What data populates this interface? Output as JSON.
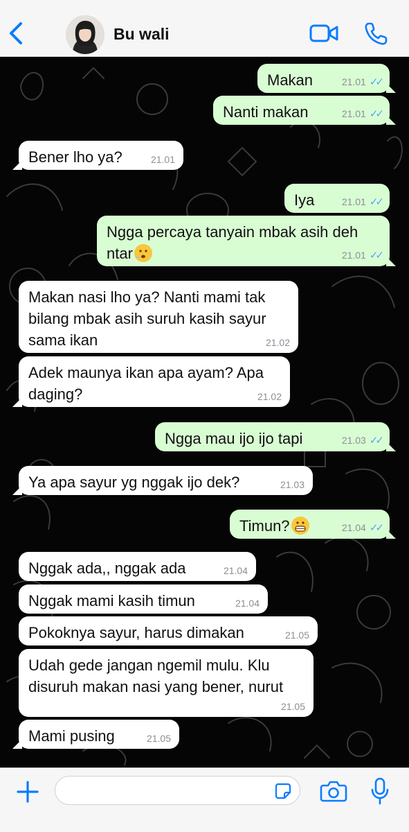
{
  "header": {
    "contact_name": "Bu wali",
    "back_icon": "chevron-left-icon",
    "video_icon": "video-camera-icon",
    "call_icon": "phone-icon"
  },
  "messages": [
    {
      "dir": "out",
      "text": "Makan",
      "time": "21.01"
    },
    {
      "dir": "out",
      "text": "Nanti makan",
      "time": "21.01"
    },
    {
      "dir": "in",
      "text": "Bener lho ya?",
      "time": "21.01"
    },
    {
      "dir": "out",
      "text": "Iya",
      "time": "21.01"
    },
    {
      "dir": "out",
      "text": "Ngga percaya tanyain mbak asih deh ntar",
      "emoji": "face-with-steam-emoji",
      "time": "21.01"
    },
    {
      "dir": "in",
      "text": "Makan nasi lho ya? Nanti mami tak bilang mbak asih suruh kasih sayur sama ikan",
      "time": "21.02"
    },
    {
      "dir": "in",
      "text": "Adek maunya ikan apa ayam? Apa daging?",
      "time": "21.02"
    },
    {
      "dir": "out",
      "text": "Ngga mau ijo ijo tapi",
      "time": "21.03"
    },
    {
      "dir": "in",
      "text": "Ya apa sayur yg nggak ijo dek?",
      "time": "21.03"
    },
    {
      "dir": "out",
      "text": "Timun?",
      "emoji": "grimacing-face-emoji",
      "time": "21.04"
    },
    {
      "dir": "in",
      "text": "Nggak ada,, nggak ada",
      "time": "21.04"
    },
    {
      "dir": "in",
      "text": "Nggak mami kasih timun",
      "time": "21.04"
    },
    {
      "dir": "in",
      "text": "Pokoknya sayur, harus dimakan",
      "time": "21.05"
    },
    {
      "dir": "in",
      "text": "Udah gede jangan ngemil mulu. Klu disuruh makan nasi yang bener, nurut",
      "time": "21.05"
    },
    {
      "dir": "in",
      "text": "Mami pusing",
      "time": "21.05"
    }
  ],
  "footer": {
    "plus_icon": "plus-icon",
    "message_value": "",
    "sticker_icon": "sticker-icon",
    "camera_icon": "camera-icon",
    "mic_icon": "microphone-icon"
  },
  "colors": {
    "outgoing_bubble": "#d9fdd3",
    "incoming_bubble": "#ffffff",
    "accent": "#0a7cff",
    "read_ticks": "#53a6fa",
    "chat_background": "#050505"
  }
}
